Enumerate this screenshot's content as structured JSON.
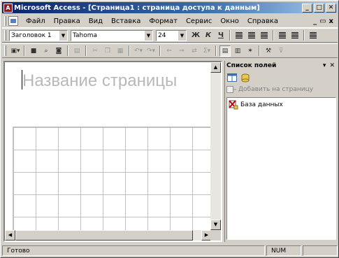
{
  "window": {
    "title": "Microsoft Access - [Страница1 : страница доступа к данным]",
    "minimize": "_",
    "maximize": "□",
    "close": "✕"
  },
  "menu": {
    "items": [
      "Файл",
      "Правка",
      "Вид",
      "Вставка",
      "Формат",
      "Сервис",
      "Окно",
      "Справка"
    ],
    "doc_minimize": "_",
    "doc_restore": "▭",
    "doc_close": "x"
  },
  "format_toolbar": {
    "style_value": "Заголовок 1",
    "font_value": "Tahoma",
    "size_value": "24",
    "bold": "Ж",
    "italic": "К",
    "underline": "Ч"
  },
  "design": {
    "page_caption": "Название страницы"
  },
  "field_list": {
    "title": "Список полей",
    "add_to_page": "Добавить на страницу",
    "tree_items": [
      "База данных"
    ]
  },
  "status": {
    "left": "Готово",
    "right": "NUM"
  }
}
